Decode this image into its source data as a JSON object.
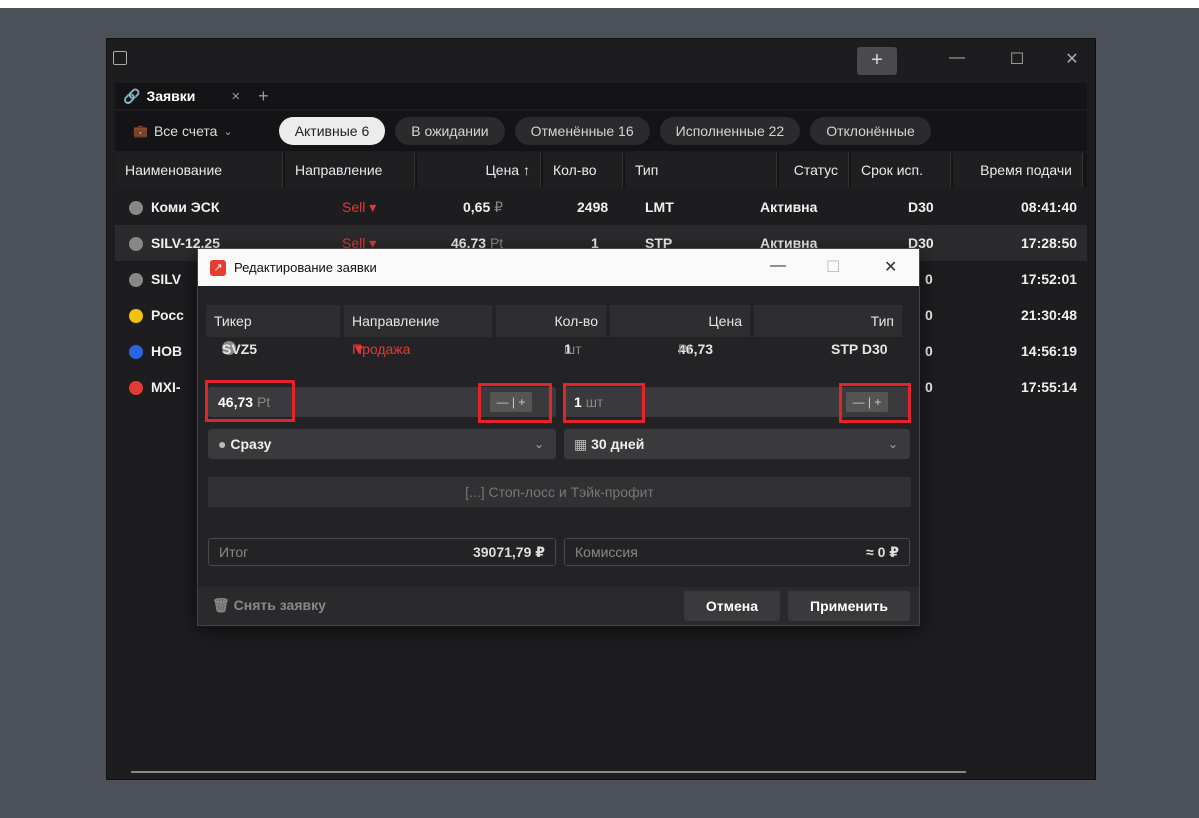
{
  "app": {
    "tab_title": "Заявки",
    "tab_close": "×",
    "tab_add": "+",
    "newtab": "+",
    "minimize": "—",
    "maximize": "☐",
    "close": "✕"
  },
  "filters": {
    "account": "Все счета",
    "pills": [
      "Активные 6",
      "В ожидании",
      "Отменённые 16",
      "Исполненные 22",
      "Отклонённые"
    ]
  },
  "table": {
    "headers": [
      "Наименование",
      "Направление",
      "Цена ↑",
      "Кол-во",
      "Тип",
      "Статус",
      "Срок исп.",
      "Время подачи"
    ],
    "rows": [
      {
        "name": "Коми ЭСК",
        "dir": "Sell ▾",
        "price": "0,65",
        "unit": "₽",
        "qty": "2498",
        "type": "LMT",
        "status": "Активна",
        "term": "D30",
        "time": "08:41:40",
        "icon_color": "#888888"
      },
      {
        "name": "SILV-12.25",
        "dir": "Sell ▾",
        "price": "46,73",
        "unit": "Pt",
        "qty": "1",
        "type": "STP",
        "status": "Активна",
        "term": "D30",
        "time": "17:28:50",
        "icon_color": "#888888"
      },
      {
        "name": "SILV",
        "term": "0",
        "time": "17:52:01",
        "icon_color": "#888888"
      },
      {
        "name": "Росс",
        "term": "0",
        "time": "21:30:48",
        "icon_color": "#f4c20d"
      },
      {
        "name": "НОВ",
        "term": "0",
        "time": "14:56:19",
        "icon_color": "#2b63e0"
      },
      {
        "name": "MXI-",
        "term": "0",
        "time": "17:55:14",
        "icon_color": "#e53935"
      }
    ]
  },
  "dialog": {
    "title": "Редактирование заявки",
    "logo": "↗",
    "headers": [
      "Тикер",
      "Направление",
      "Кол-во",
      "Цена",
      "Тип"
    ],
    "ticker": "SVZ5",
    "direction": "Продажа",
    "qty": "1",
    "qty_unit": "шт",
    "price": "46,73",
    "price_unit": "Pt",
    "type": "STP D30",
    "price_field": "46,73",
    "price_field_unit": "Pt",
    "qty_field": "1",
    "qty_field_unit": "шт",
    "stepper": "— | +",
    "exec_mode": "Сразу",
    "duration": "30 дней",
    "stoploss": "[...] Стоп-лосс и Тэйк-профит",
    "total_label": "Итог",
    "total_value": "39071,79 ₽",
    "commission_label": "Комиссия",
    "commission_value": "≈ 0 ₽",
    "cancel_order": "Снять заявку",
    "cancel": "Отмена",
    "apply": "Применить"
  }
}
